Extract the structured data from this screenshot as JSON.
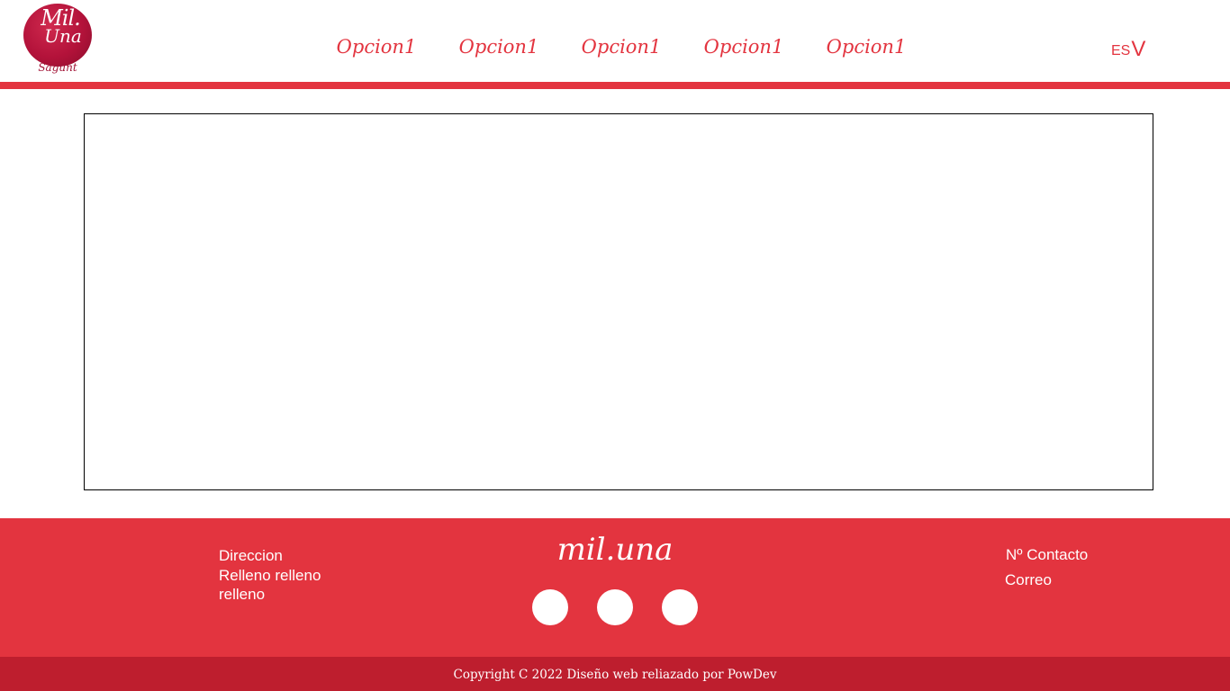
{
  "header": {
    "logo": {
      "line1": "Mil.",
      "line2": "Una",
      "line3": "Sagunt"
    },
    "nav": {
      "items": [
        {
          "label": "Opcion1"
        },
        {
          "label": "Opcion1"
        },
        {
          "label": "Opcion1"
        },
        {
          "label": "Opcion1"
        },
        {
          "label": "Opcion1"
        }
      ]
    },
    "language": {
      "code": "ES",
      "chevron": "V"
    }
  },
  "footer": {
    "address": {
      "title": "Direccion",
      "line1": "Relleno relleno",
      "line2": "relleno"
    },
    "brand": "mil.una",
    "contact_label": "Nº Contacto",
    "email_label": "Correo",
    "copyright": "Copyright C 2022 Diseño web reliazado por PowDev"
  },
  "colors": {
    "accent": "#e3343f",
    "accent_dark": "#be1e2e",
    "logo": "#b3123a",
    "background": "#ffffff"
  },
  "icons": {
    "social": [
      "social-icon-1",
      "social-icon-2",
      "social-icon-3"
    ]
  }
}
